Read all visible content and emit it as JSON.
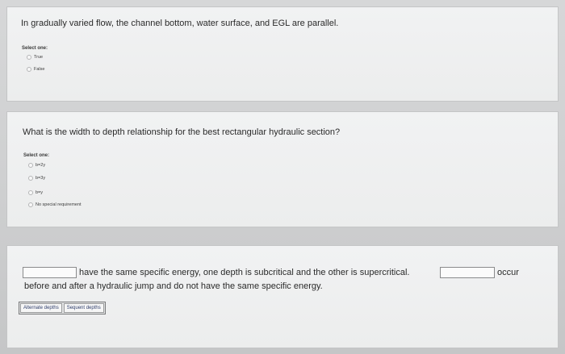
{
  "q1": {
    "text": "In gradually varied flow, the channel bottom, water surface, and EGL are parallel.",
    "select_label": "Select one:",
    "options": [
      "True",
      "False"
    ]
  },
  "q2": {
    "text": "What is the width to depth relationship for the best rectangular hydraulic section?",
    "select_label": "Select one:",
    "options": [
      "b=2y",
      "b=3y",
      "b=y",
      "No special requirement"
    ]
  },
  "q3": {
    "part1": "have the same specific energy, one depth is subcritical and the other is supercritical.",
    "part2": "occur",
    "part3": "before and after a hydraulic jump and do not have the same specific energy.",
    "choices": [
      "Alternate depths",
      "Sequent depths"
    ]
  }
}
